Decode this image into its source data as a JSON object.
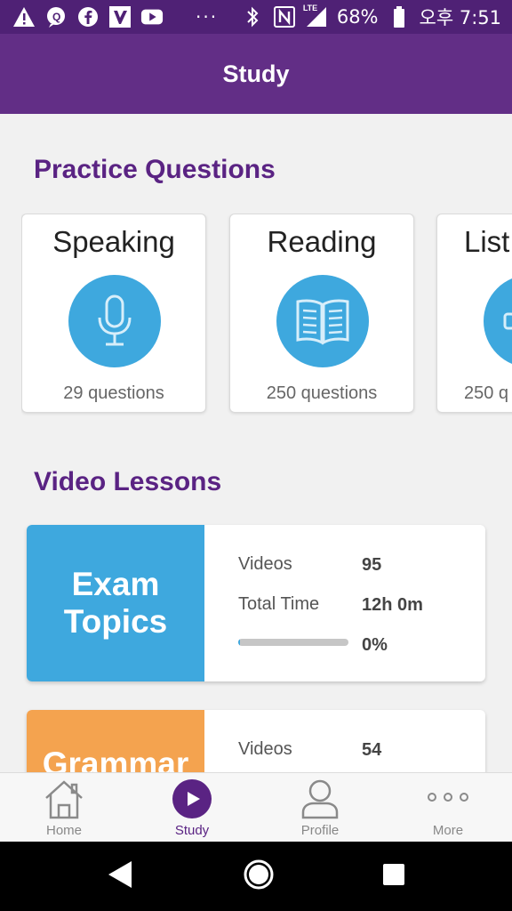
{
  "status_bar": {
    "battery": "68%",
    "time": "오후 7:51",
    "dots": "···",
    "network": "LTE",
    "icons": [
      "warning-icon",
      "chat-icon",
      "facebook-icon",
      "app-icon",
      "youtube-icon",
      "bluetooth-icon",
      "nfc-icon",
      "signal-icon",
      "battery-icon"
    ]
  },
  "app_bar": {
    "title": "Study"
  },
  "practice": {
    "heading": "Practice Questions",
    "cards": [
      {
        "title": "Speaking",
        "count": "29 questions",
        "icon": "microphone-icon"
      },
      {
        "title": "Reading",
        "count": "250 questions",
        "icon": "book-icon"
      },
      {
        "title": "List",
        "count": "250 q",
        "icon": "headphones-icon"
      }
    ]
  },
  "video": {
    "heading": "Video Lessons",
    "lessons": [
      {
        "title": "Exam Topics",
        "title_line1": "Exam",
        "title_line2": "Topics",
        "color": "#3ea8de",
        "videos_label": "Videos",
        "videos": "95",
        "time_label": "Total Time",
        "time": "12h 0m",
        "progress_text": "0%",
        "progress": 0.02
      },
      {
        "title": "Grammar",
        "title_line1": "Grammar",
        "color": "#f4a34f",
        "videos_label": "Videos",
        "videos": "54"
      }
    ]
  },
  "bottom_nav": {
    "items": [
      {
        "label": "Home",
        "icon": "home-icon"
      },
      {
        "label": "Study",
        "icon": "play-icon",
        "active": true
      },
      {
        "label": "Profile",
        "icon": "profile-icon"
      },
      {
        "label": "More",
        "icon": "more-icon"
      }
    ]
  },
  "colors": {
    "primary": "#622e86",
    "status": "#4f2175",
    "accent": "#3ea8de",
    "grammar": "#f4a34f"
  }
}
